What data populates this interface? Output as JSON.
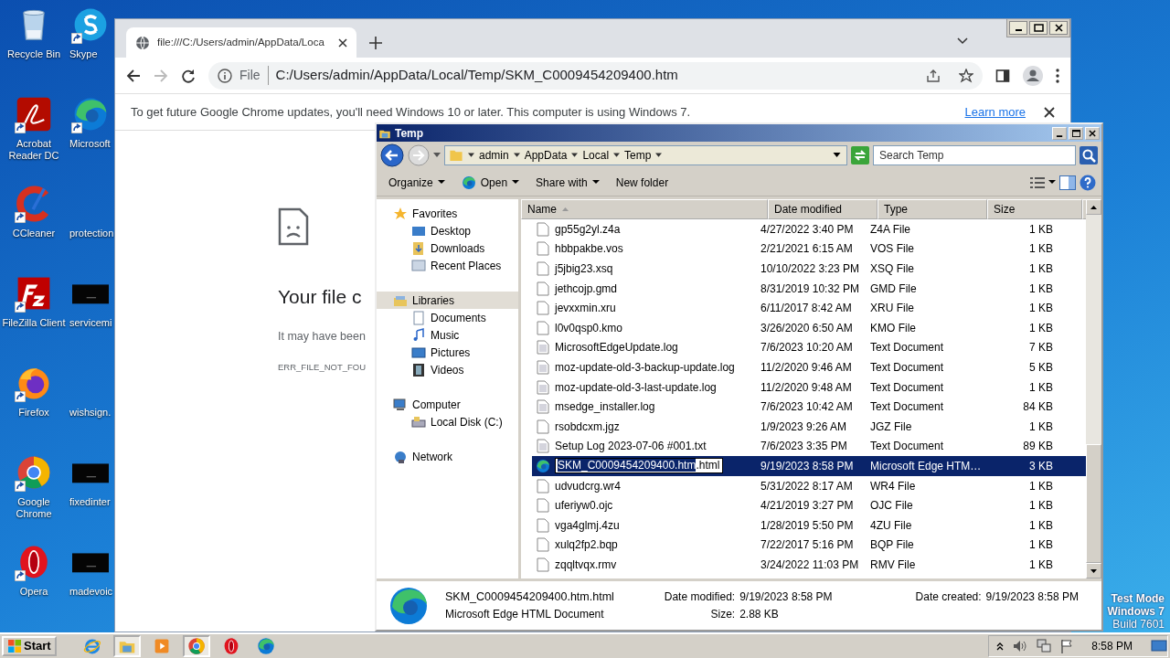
{
  "desktop": {
    "icons": [
      {
        "label": "Recycle Bin",
        "kind": "recycle",
        "shortcut": false
      },
      {
        "label": "Skype",
        "kind": "skype",
        "shortcut": true
      },
      {
        "label": "Acrobat Reader DC",
        "kind": "acrobat",
        "shortcut": true
      },
      {
        "label": "Microsoft",
        "kind": "edge",
        "shortcut": true
      },
      {
        "label": "CCleaner",
        "kind": "ccleaner",
        "shortcut": true
      },
      {
        "label": "protection",
        "kind": "none",
        "shortcut": false
      },
      {
        "label": "FileZilla Client",
        "kind": "filezilla",
        "shortcut": true
      },
      {
        "label": "servicemi",
        "kind": "console",
        "shortcut": false
      },
      {
        "label": "Firefox",
        "kind": "firefox",
        "shortcut": true
      },
      {
        "label": "wishsign.",
        "kind": "none",
        "shortcut": false
      },
      {
        "label": "Google Chrome",
        "kind": "chrome",
        "shortcut": true
      },
      {
        "label": "fixedinter",
        "kind": "console",
        "shortcut": false
      },
      {
        "label": "Opera",
        "kind": "opera",
        "shortcut": true
      },
      {
        "label": "madevoic",
        "kind": "console",
        "shortcut": false
      }
    ],
    "notice": [
      "Test Mode",
      "Windows 7",
      "Build 7601"
    ]
  },
  "browser": {
    "tab": {
      "title": "file:///C:/Users/admin/AppData/Loca",
      "selected": true
    },
    "nav": {
      "back_disabled": false,
      "forward_disabled": true
    },
    "omnibox": {
      "scheme": "File",
      "url": "C:/Users/admin/AppData/Local/Temp/SKM_C0009454209400.htm"
    },
    "infobar": {
      "message": "To get future Google Chrome updates, you'll need Windows 10 or later. This computer is using Windows 7.",
      "link": "Learn more"
    },
    "error": {
      "heading": "Your file c",
      "detail": "It may have been",
      "code": "ERR_FILE_NOT_FOU"
    }
  },
  "explorer": {
    "title": "Temp",
    "breadcrumb": [
      "admin",
      "AppData",
      "Local",
      "Temp"
    ],
    "search": {
      "placeholder": "Search Temp"
    },
    "toolbar": [
      {
        "label": "Organize",
        "kind": "menu"
      },
      {
        "label": "Open",
        "kind": "appmenu"
      },
      {
        "label": "Share with",
        "kind": "menu"
      },
      {
        "label": "New folder",
        "kind": "button"
      }
    ],
    "nav": [
      {
        "label": "Favorites",
        "kind": "star",
        "selected": false,
        "children": [
          {
            "label": "Desktop",
            "kind": "desktop",
            "selected": false
          },
          {
            "label": "Downloads",
            "kind": "downloads",
            "selected": false
          },
          {
            "label": "Recent Places",
            "kind": "recent",
            "selected": false
          }
        ]
      },
      {
        "label": "Libraries",
        "kind": "library",
        "selected": true,
        "children": [
          {
            "label": "Documents",
            "kind": "documents",
            "selected": false
          },
          {
            "label": "Music",
            "kind": "music",
            "selected": false
          },
          {
            "label": "Pictures",
            "kind": "pictures",
            "selected": false
          },
          {
            "label": "Videos",
            "kind": "videos",
            "selected": false
          }
        ]
      },
      {
        "label": "Computer",
        "kind": "computer",
        "selected": false,
        "children": [
          {
            "label": "Local Disk (C:)",
            "kind": "disk",
            "selected": false
          }
        ]
      },
      {
        "label": "Network",
        "kind": "network",
        "selected": false
      }
    ],
    "columns": [
      {
        "label": "Name",
        "sorted": true
      },
      {
        "label": "Date modified",
        "sorted": false
      },
      {
        "label": "Type",
        "sorted": false
      },
      {
        "label": "Size",
        "sorted": false
      }
    ],
    "files": [
      {
        "name": "gp55g2yl.z4a",
        "date": "4/27/2022 3:40 PM",
        "type": "Z4A File",
        "size": "1 KB",
        "kind": "blank",
        "selected": false,
        "editing": false
      },
      {
        "name": "hbbpakbe.vos",
        "date": "2/21/2021 6:15 AM",
        "type": "VOS File",
        "size": "1 KB",
        "kind": "blank",
        "selected": false,
        "editing": false
      },
      {
        "name": "j5jbig23.xsq",
        "date": "10/10/2022 3:23 PM",
        "type": "XSQ File",
        "size": "1 KB",
        "kind": "blank",
        "selected": false,
        "editing": false
      },
      {
        "name": "jethcojp.gmd",
        "date": "8/31/2019 10:32 PM",
        "type": "GMD File",
        "size": "1 KB",
        "kind": "blank",
        "selected": false,
        "editing": false
      },
      {
        "name": "jevxxmin.xru",
        "date": "6/11/2017 8:42 AM",
        "type": "XRU File",
        "size": "1 KB",
        "kind": "blank",
        "selected": false,
        "editing": false
      },
      {
        "name": "l0v0qsp0.kmo",
        "date": "3/26/2020 6:50 AM",
        "type": "KMO File",
        "size": "1 KB",
        "kind": "blank",
        "selected": false,
        "editing": false
      },
      {
        "name": "MicrosoftEdgeUpdate.log",
        "date": "7/6/2023 10:20 AM",
        "type": "Text Document",
        "size": "7 KB",
        "kind": "text",
        "selected": false,
        "editing": false
      },
      {
        "name": "moz-update-old-3-backup-update.log",
        "date": "11/2/2020 9:46 AM",
        "type": "Text Document",
        "size": "5 KB",
        "kind": "text",
        "selected": false,
        "editing": false
      },
      {
        "name": "moz-update-old-3-last-update.log",
        "date": "11/2/2020 9:48 AM",
        "type": "Text Document",
        "size": "1 KB",
        "kind": "text",
        "selected": false,
        "editing": false
      },
      {
        "name": "msedge_installer.log",
        "date": "7/6/2023 10:42 AM",
        "type": "Text Document",
        "size": "84 KB",
        "kind": "text",
        "selected": false,
        "editing": false
      },
      {
        "name": "rsobdcxm.jgz",
        "date": "1/9/2023 9:26 AM",
        "type": "JGZ File",
        "size": "1 KB",
        "kind": "blank",
        "selected": false,
        "editing": false
      },
      {
        "name": "Setup Log 2023-07-06 #001.txt",
        "date": "7/6/2023 3:35 PM",
        "type": "Text Document",
        "size": "89 KB",
        "kind": "text",
        "selected": false,
        "editing": false
      },
      {
        "name": "SKM_C0009454209400.htm",
        "name_rest": ".html",
        "date": "9/19/2023 8:58 PM",
        "type": "Microsoft Edge HTM…",
        "size": "3 KB",
        "kind": "edge",
        "selected": true,
        "editing": true
      },
      {
        "name": "udvudcrg.wr4",
        "date": "5/31/2022 8:17 AM",
        "type": "WR4 File",
        "size": "1 KB",
        "kind": "blank",
        "selected": false,
        "editing": false
      },
      {
        "name": "uferiyw0.ojc",
        "date": "4/21/2019 3:27 PM",
        "type": "OJC File",
        "size": "1 KB",
        "kind": "blank",
        "selected": false,
        "editing": false
      },
      {
        "name": "vga4glmj.4zu",
        "date": "1/28/2019 5:50 PM",
        "type": "4ZU File",
        "size": "1 KB",
        "kind": "blank",
        "selected": false,
        "editing": false
      },
      {
        "name": "xulq2fp2.bqp",
        "date": "7/22/2017 5:16 PM",
        "type": "BQP File",
        "size": "1 KB",
        "kind": "blank",
        "selected": false,
        "editing": false
      },
      {
        "name": "zqqltvqx.rmv",
        "date": "3/24/2022 11:03 PM",
        "type": "RMV File",
        "size": "1 KB",
        "kind": "blank",
        "selected": false,
        "editing": false
      }
    ],
    "details": {
      "name": "SKM_C0009454209400.htm.html",
      "type": "Microsoft Edge HTML Document",
      "fields": [
        {
          "label": "Date modified:",
          "value": "9/19/2023 8:58 PM"
        },
        {
          "label": "Size:",
          "value": "2.88 KB"
        },
        {
          "label": "Date created:",
          "value": "9/19/2023 8:58 PM"
        }
      ]
    }
  },
  "taskbar": {
    "start": "Start",
    "apps": [
      {
        "kind": "ie",
        "active": false
      },
      {
        "kind": "explorer",
        "active": true
      },
      {
        "kind": "media",
        "active": false
      },
      {
        "kind": "chrome",
        "active": true
      },
      {
        "kind": "opera",
        "active": false
      },
      {
        "kind": "edge",
        "active": false
      }
    ],
    "clock": "8:58 PM"
  }
}
